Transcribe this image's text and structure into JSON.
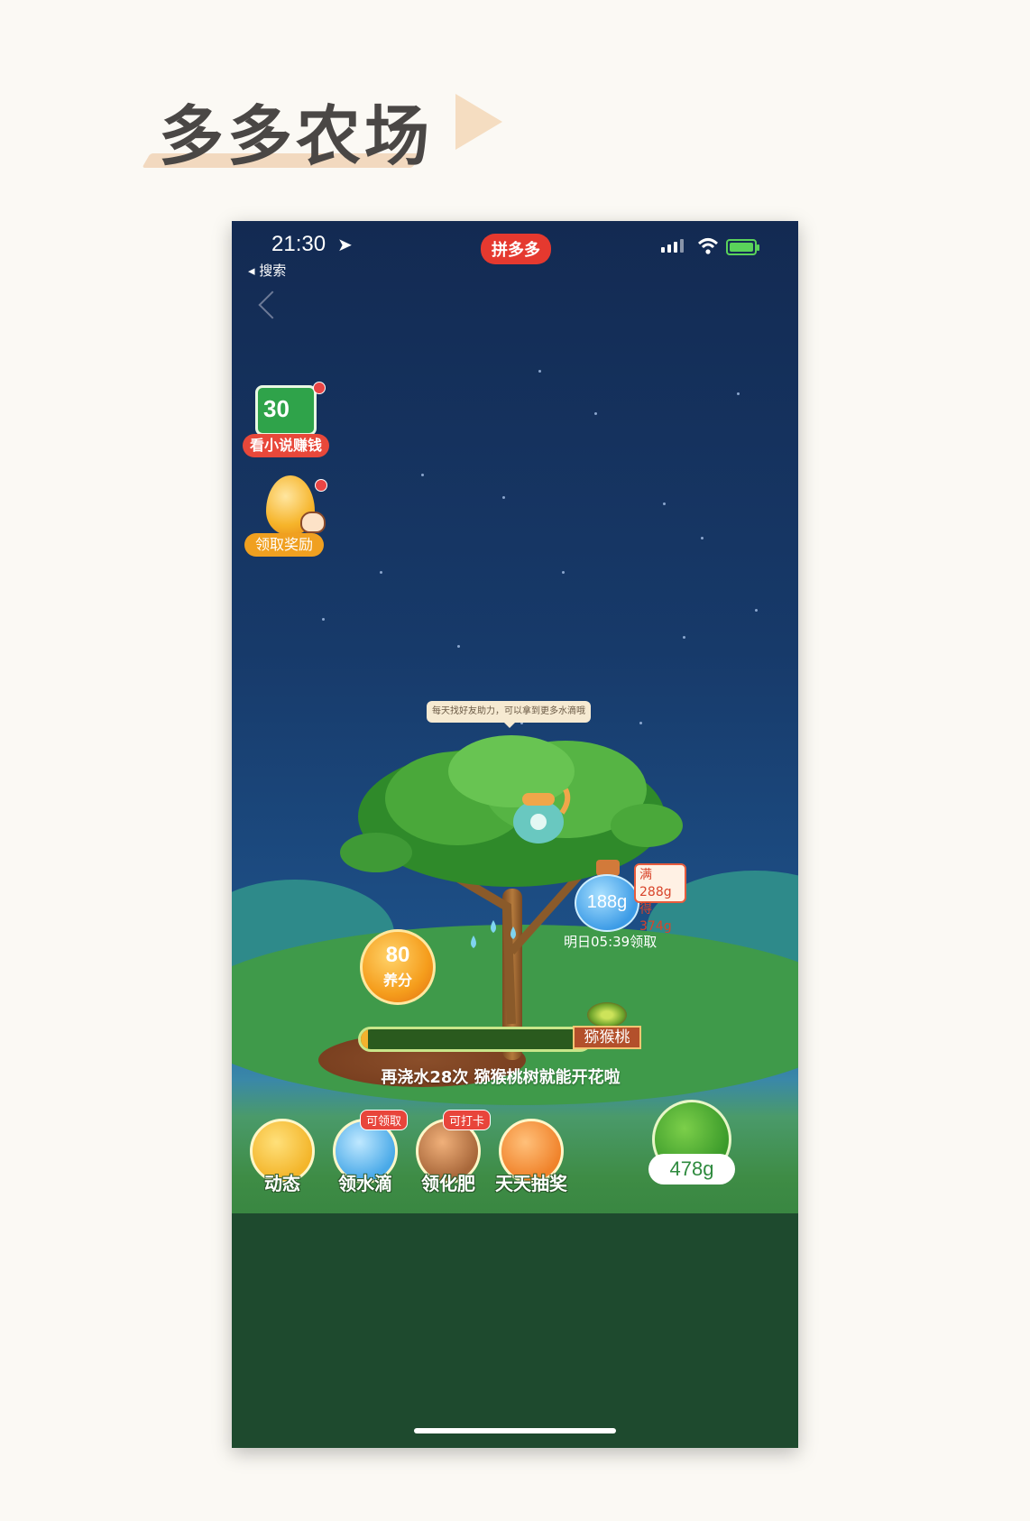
{
  "page": {
    "title": "多多农场"
  },
  "status": {
    "time": "21:30",
    "back_app": "◂ 搜索",
    "app_name": "拼多多"
  },
  "promos": {
    "novel_amount": "30",
    "novel_label": "看小说赚钱",
    "reward_label": "领取奖励"
  },
  "tip": "每天找好友助力，可以拿到更多水滴哦",
  "points": {
    "value": "80",
    "unit": "养分"
  },
  "bottle": {
    "amount": "188g",
    "tag_line1": "满288g",
    "tag_line2": "得374g",
    "claim_time": "明日05:39领取"
  },
  "progress": {
    "fruit": "猕猴桃",
    "fill_fraction": 0.03,
    "hint": "再浇水28次 猕猴桃树就能开花啦"
  },
  "toolbar": {
    "items": [
      {
        "label": "动态",
        "tag": "",
        "color": "#f3b52a"
      },
      {
        "label": "领水滴",
        "tag": "可领取",
        "color": "#49a9e8"
      },
      {
        "label": "领化肥",
        "tag": "可打卡",
        "color": "#a8673a"
      },
      {
        "label": "天天抽奖",
        "tag": "",
        "color": "#f0822a"
      }
    ],
    "water_amount": "478g"
  }
}
